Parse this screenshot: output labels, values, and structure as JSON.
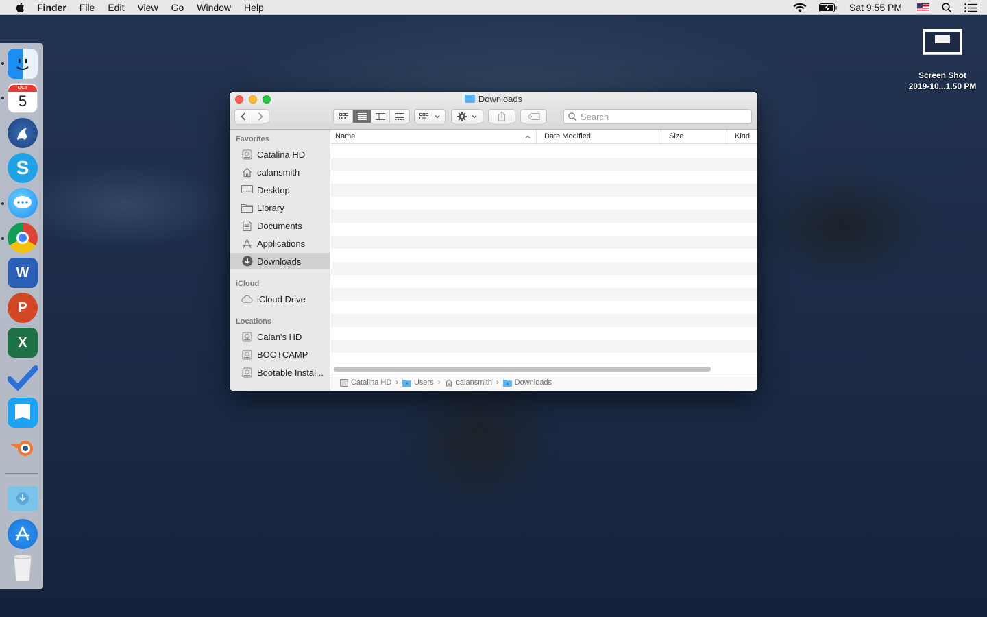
{
  "menubar": {
    "apple_icon": "apple-logo-icon",
    "app_name": "Finder",
    "items": [
      "File",
      "Edit",
      "View",
      "Go",
      "Window",
      "Help"
    ],
    "clock": "Sat 9:55 PM",
    "status_icons": [
      "wifi-icon",
      "battery-charging-icon",
      "us-flag-input-icon",
      "spotlight-search-icon",
      "notification-center-icon"
    ]
  },
  "dock": {
    "calendar": {
      "month": "OCT",
      "day": "5"
    },
    "apps": [
      "Finder",
      "Calendar",
      "Mail",
      "Skype",
      "Messages",
      "Google Chrome",
      "Microsoft Word",
      "Microsoft PowerPoint",
      "Microsoft Excel",
      "To Do",
      "Kindle",
      "Blender",
      "Downloads",
      "App Store",
      "Trash"
    ]
  },
  "desktop": {
    "file_label_line1": "Screen Shot",
    "file_label_line2": "2019-10...1.50 PM"
  },
  "window": {
    "title": "Downloads",
    "search_placeholder": "Search",
    "sidebar": {
      "favorites_header": "Favorites",
      "favorites": [
        {
          "label": "Catalina HD",
          "icon": "hard-drive-icon"
        },
        {
          "label": "calansmith",
          "icon": "home-icon"
        },
        {
          "label": "Desktop",
          "icon": "desktop-icon"
        },
        {
          "label": "Library",
          "icon": "folder-icon"
        },
        {
          "label": "Documents",
          "icon": "document-icon"
        },
        {
          "label": "Applications",
          "icon": "applications-icon"
        },
        {
          "label": "Downloads",
          "icon": "downloads-icon"
        }
      ],
      "icloud_header": "iCloud",
      "icloud": [
        {
          "label": "iCloud Drive",
          "icon": "cloud-icon"
        }
      ],
      "locations_header": "Locations",
      "locations": [
        {
          "label": "Calan's HD",
          "icon": "hard-drive-icon"
        },
        {
          "label": "BOOTCAMP",
          "icon": "hard-drive-icon"
        },
        {
          "label": "Bootable Instal...",
          "icon": "hard-drive-icon"
        }
      ]
    },
    "columns": {
      "name": "Name",
      "date_modified": "Date Modified",
      "size": "Size",
      "kind": "Kind"
    },
    "path": [
      "Catalina HD",
      "Users",
      "calansmith",
      "Downloads"
    ]
  },
  "colors": {
    "accent": "#5ab4f0",
    "close": "#fc5f57",
    "minimize": "#fdbc2e",
    "zoom": "#28c940"
  }
}
